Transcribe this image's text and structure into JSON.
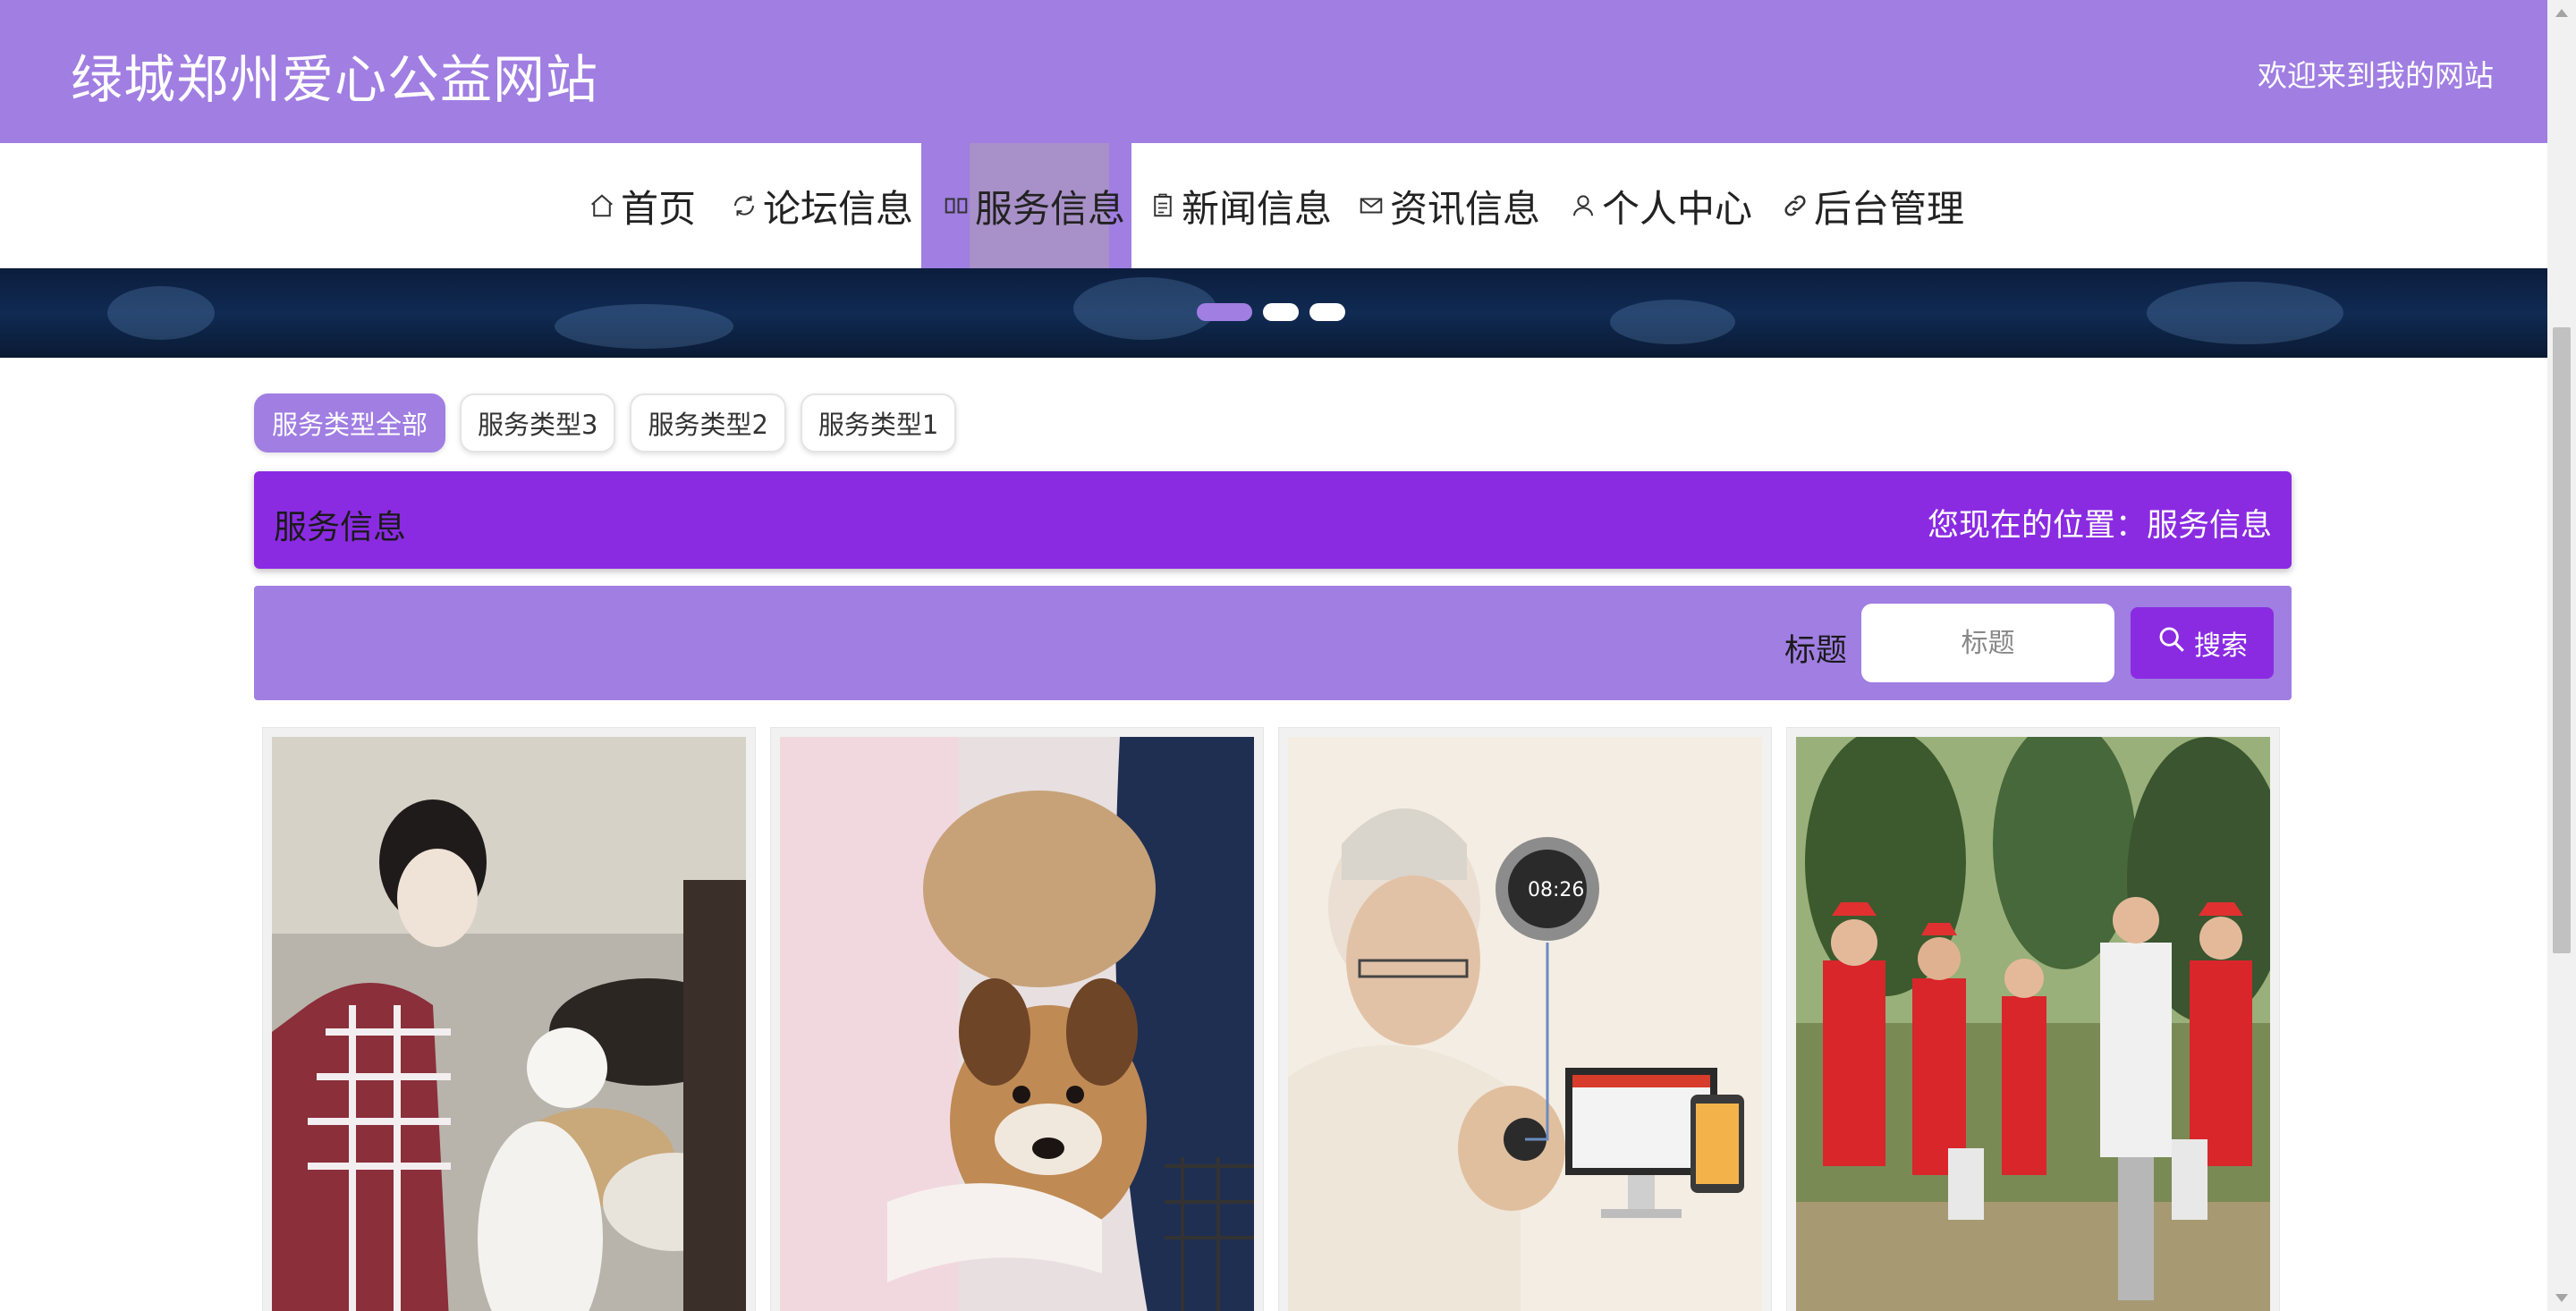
{
  "header": {
    "site_title": "绿城郑州爱心公益网站",
    "welcome": "欢迎来到我的网站"
  },
  "nav": {
    "items": [
      {
        "label": "首页",
        "icon": "home-icon"
      },
      {
        "label": "论坛信息",
        "icon": "forum-icon"
      },
      {
        "label": "服务信息",
        "icon": "service-icon",
        "active": true
      },
      {
        "label": "新闻信息",
        "icon": "news-icon"
      },
      {
        "label": "资讯信息",
        "icon": "mail-icon"
      },
      {
        "label": "个人中心",
        "icon": "user-icon"
      },
      {
        "label": "后台管理",
        "icon": "link-icon"
      }
    ]
  },
  "carousel": {
    "slide_count": 3,
    "active_index": 0
  },
  "filters": {
    "chips": [
      "服务类型全部",
      "服务类型3",
      "服务类型2",
      "服务类型1"
    ],
    "active_index": 0
  },
  "section": {
    "title": "服务信息",
    "location": "您现在的位置：服务信息"
  },
  "search": {
    "label": "标题",
    "placeholder": "标题",
    "button_label": "搜索"
  },
  "cards": [
    {
      "image": "volunteer-with-dogs-photo"
    },
    {
      "image": "puppy-care-photo"
    },
    {
      "image": "elderly-smartwatch-photo"
    },
    {
      "image": "volunteers-cleanup-photo"
    }
  ],
  "colors": {
    "accent": "#a07ee2",
    "primary": "#8a2be2",
    "nav_highlight": "#a890c8"
  }
}
